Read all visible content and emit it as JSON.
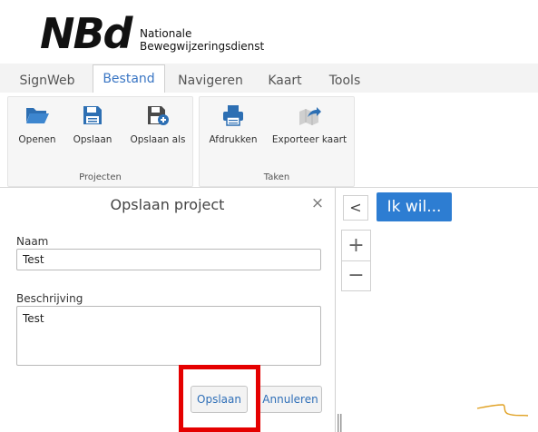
{
  "logo": {
    "mark": "NBd",
    "line1": "Nationale",
    "line2": "Bewegwijzeringsdienst"
  },
  "menu": {
    "tabs": [
      "SignWeb",
      "Bestand",
      "Navigeren",
      "Kaart",
      "Tools"
    ],
    "active": "Bestand"
  },
  "ribbon": {
    "groups": [
      {
        "label": "Projecten",
        "buttons": [
          "Openen",
          "Opslaan",
          "Opslaan als"
        ]
      },
      {
        "label": "Taken",
        "buttons": [
          "Afdrukken",
          "Exporteer kaart"
        ]
      }
    ]
  },
  "dialog": {
    "title": "Opslaan project",
    "close": "×",
    "name_label": "Naam",
    "name_value": "Test",
    "description_label": "Beschrijving",
    "description_value": "Test",
    "save_label": "Opslaan",
    "cancel_label": "Annuleren"
  },
  "map": {
    "collapse": "<",
    "ikwil_label": "Ik wil...",
    "zoom_in": "+",
    "zoom_out": "−"
  },
  "colors": {
    "accent": "#2d7dd2",
    "highlight": "#e50000",
    "active_tab_text": "#3a76c4"
  },
  "icons": {
    "openen": "folder-open-icon",
    "opslaan": "floppy-disk-icon",
    "opslaan_als": "floppy-disk-plus-icon",
    "afdrukken": "printer-icon",
    "exporteer": "export-arrow-icon"
  }
}
